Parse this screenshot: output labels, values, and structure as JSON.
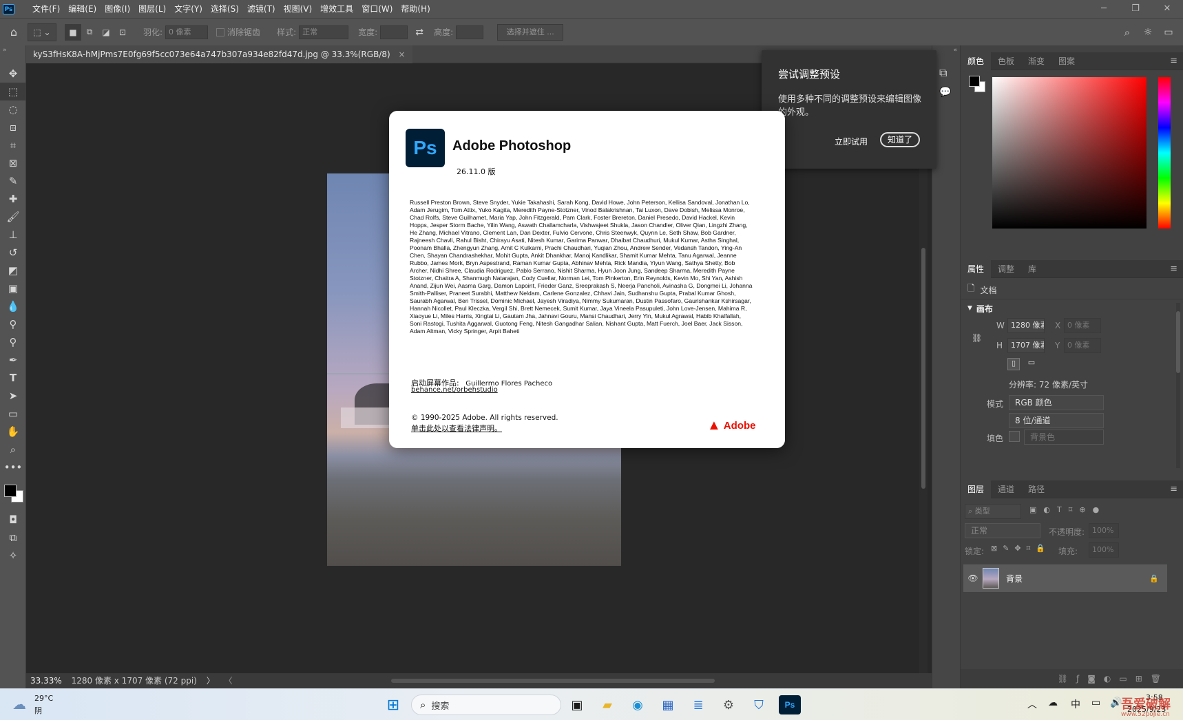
{
  "menubar": {
    "logo": "Ps",
    "items": [
      "文件(F)",
      "编辑(E)",
      "图像(I)",
      "图层(L)",
      "文字(Y)",
      "选择(S)",
      "滤镜(T)",
      "视图(V)",
      "增效工具",
      "窗口(W)",
      "帮助(H)"
    ]
  },
  "options": {
    "feather_label": "羽化:",
    "feather_value": "0 像素",
    "antialias_label": "消除锯齿",
    "style_label": "样式:",
    "style_value": "正常",
    "width_label": "宽度:",
    "height_label": "高度:",
    "select_mask": "选择并遮住 ..."
  },
  "document": {
    "tab_title": "kyS3fHsK8A-hMjPms7E0fg69f5cc073e64a747b307a934e82fd47d.jpg @ 33.3%(RGB/8)",
    "close": "×"
  },
  "status": {
    "zoom": "33.33%",
    "info": "1280 像素 x 1707 像素 (72 ppi)",
    "arrow": "〉",
    "arrow_left": "〈"
  },
  "hint": {
    "title": "尝试调整预设",
    "body": "使用多种不同的调整预设来编辑图像的外观。",
    "try": "立即试用",
    "ok": "知道了"
  },
  "about": {
    "logo": "Ps",
    "title": "Adobe Photoshop",
    "version": "26.11.0 版",
    "credits": "Russell Preston Brown, Steve Snyder, Yukie Takahashi, Sarah Kong, David Howe, John Peterson, Kellisa Sandoval, Jonathan Lo, Adam Jerugim, Tom Attix, Yuko Kagita, Meredith Payne-Stotzner, Vinod Balakrishnan, Tai Luxon, Dave Dobish, Melissa Monroe, Chad Rolfs, Steve Guilhamet, Maria Yap, John Fitzgerald, Pam Clark, Foster Brereton, Daniel Presedo, David Hackel, Kevin Hopps, Jesper Storm Bache, Yilin Wang, Aswath Challamcharla, Vishwajeet Shukla, Jason Chandler, Oliver Qian, Lingzhi Zhang, He Zhang, Michael Vitrano, Clement Lan, Dan Dexter, Fulvio Cervone, Chris Steenwyk, Quynn Le, Seth Shaw, Bob Gardner, Rajneesh Chavli, Rahul Bisht, Chirayu Asati, Nitesh Kumar, Garima Panwar, Dhaibat Chaudhuri, Mukul Kumar, Astha Singhal, Poonam Bhalla, Zhengyun Zhang, Amit C Kulkarni, Prachi Chaudhari, Yuqian Zhou, Andrew Sender, Vedansh Tandon, Ying-An Chen, Shayan Chandrashekhar, Mohit Gupta, Ankit Dhankhar, Manoj Kandlikar, Shamit Kumar Mehta, Tanu Agarwal, Jeanne Rubbo, James Mork, Bryn Aspestrand, Raman Kumar Gupta, Abhinav Mehta, Rick Mandia, Yiyun Wang, Sathya Shetty, Bob Archer, Nidhi Shree, Claudia Rodriguez, Pablo Serrano, Nishit Sharma, Hyun Joon Jung, Sandeep Sharma, Meredith Payne Stotzner, Chaitra A, Shanmugh Natarajan, Cody Cuellar, Norman Lei, Tom Pinkerton, Erin Reynolds, Kevin Mo, Shi Yan, Ashish Anand, Zijun Wei, Aasma Garg, Damon Lapoint, Frieder Ganz, Sreeprakash S, Neerja Pancholi, Avinasha G, Dongmei Li, Johanna Smith-Palliser, Praneet Surabhi, Matthew Neldam, Carlene Gonzalez, Chhavi Jain, Sudhanshu Gupta, Prabal Kumar Ghosh, Saurabh Agarwal, Ben Trissel, Dominic Michael, Jayesh Viradiya, Nimmy Sukumaran, Dustin Passofaro, Gaurishankar Kshirsagar, Hannah Nicollet, Paul Kleczka, Vergil Shi, Brett Nemecek, Sumit Kumar, Jaya Vineela Pasupuleti, John Love-Jensen, Mahima R, Xiaoyue Li, Miles Harris, Xingtai Li, Gautam Jha, Jahnavi Gouru, Mansi Chaudhari, Jerry Yin, Mukul Agrawal, Habib Khalfallah, Soni Rastogi, Tushita Aggarwal, Guotong Feng, Nitesh Gangadhar Salian, Nishant Gupta, Matt Fuerch, Joel Baer, Jack Sisson, Adam Altman, Vicky Springer, Arpit Baheti",
    "splash_label": "启动屏幕作品:",
    "splash_author": "Guillermo Flores Pacheco",
    "splash_link": "behance.net/orbehstudio",
    "copyright": "© 1990-2025 Adobe. All rights reserved.",
    "legal": "单击此处以查看法律声明。",
    "adobe": "Adobe"
  },
  "color_panel": {
    "tabs": [
      "颜色",
      "色板",
      "渐变",
      "图案"
    ]
  },
  "props_panel": {
    "tabs": [
      "属性",
      "调整",
      "库"
    ],
    "doc_label": "文档",
    "canvas": "画布",
    "w_label": "W",
    "w_value": "1280 像素",
    "x_label": "X",
    "x_value": "0 像素",
    "h_label": "H",
    "h_value": "1707 像素",
    "y_label": "Y",
    "y_value": "0 像素",
    "resolution": "分辨率: 72 像素/英寸",
    "mode_label": "模式",
    "mode_value": "RGB 颜色",
    "depth_value": "8 位/通道",
    "fill_label": "填色",
    "fill_value": "背景色"
  },
  "layers_panel": {
    "tabs": [
      "图层",
      "通道",
      "路径"
    ],
    "kind": "类型",
    "blend": "正常",
    "opacity_label": "不透明度:",
    "opacity": "100%",
    "lock_label": "锁定:",
    "fill_label": "填充:",
    "fill": "100%",
    "layer_name": "背景"
  },
  "taskbar": {
    "temp": "29°C",
    "weather": "阴",
    "search": "搜索",
    "ime": "中",
    "time": "3:58",
    "date": "2025/9/23",
    "watermark": "吾爱破解",
    "watermark_url": "www.52pojie.cn"
  }
}
